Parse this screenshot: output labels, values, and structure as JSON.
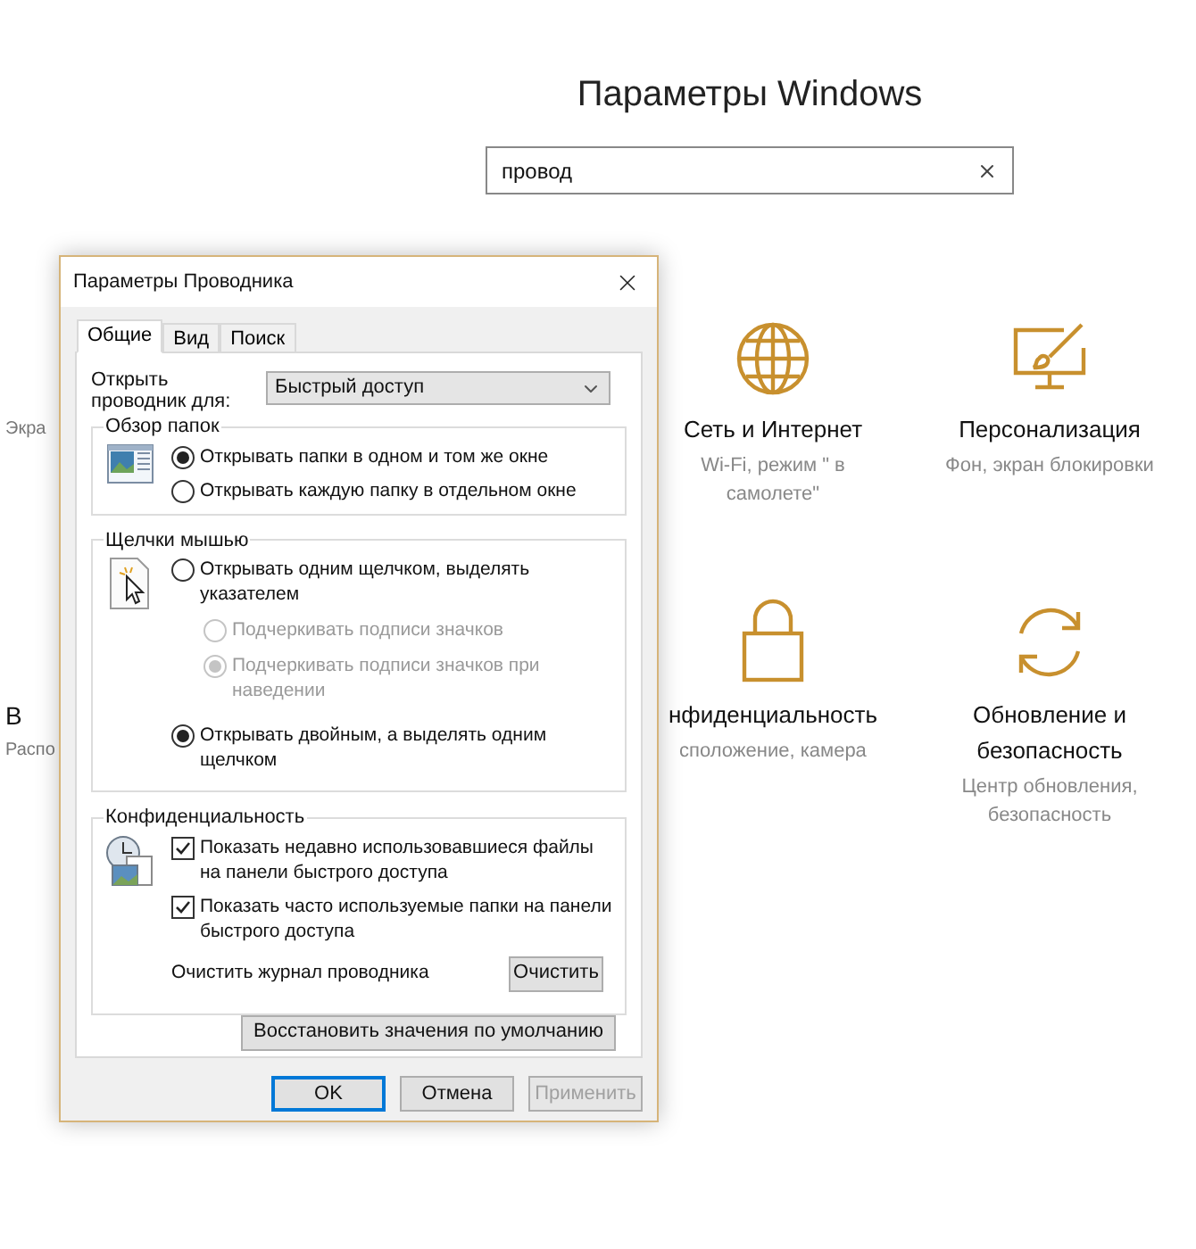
{
  "settings": {
    "title": "Параметры Windows",
    "search": {
      "value": "провод"
    },
    "rows": [
      [
        {
          "kind": "partial",
          "subtitle": "Экра"
        },
        {
          "kind": "full",
          "title": "Сеть и Интернет",
          "subtitle": "Wi-Fi, режим \" в самолете\""
        },
        {
          "kind": "full",
          "title": "Персонализация",
          "subtitle": "Фон, экран блокировки"
        }
      ],
      [
        {
          "kind": "partial",
          "title": "В",
          "subtitle": "Распо"
        },
        {
          "kind": "full",
          "title": "нфиденциальность",
          "subtitle": "сположение, камера"
        },
        {
          "kind": "full",
          "title": "Обновление и безопасность",
          "subtitle": "Центр обновления, безопасность"
        }
      ]
    ]
  },
  "dialog": {
    "title": "Параметры Проводника",
    "tabs": [
      {
        "label": "Общие",
        "selected": true
      },
      {
        "label": "Вид",
        "selected": false
      },
      {
        "label": "Поиск",
        "selected": false
      }
    ],
    "open_for": {
      "label": "Открыть проводник для:",
      "value": "Быстрый доступ"
    },
    "groups": [
      {
        "title": "Обзор папок",
        "options": [
          {
            "kind": "radio",
            "label": "Открывать папки в одном и том же окне",
            "selected": true,
            "disabled": false
          },
          {
            "kind": "radio",
            "label": "Открывать каждую папку в отдельном окне",
            "selected": false,
            "disabled": false
          }
        ]
      },
      {
        "title": "Щелчки мышью",
        "options": [
          {
            "kind": "radio",
            "label": "Открывать одним щелчком, выделять указателем",
            "selected": false,
            "disabled": false,
            "children": [
              {
                "kind": "radio",
                "label": "Подчеркивать подписи значков",
                "selected": false,
                "disabled": true
              },
              {
                "kind": "radio",
                "label": "Подчеркивать подписи значков при наведении",
                "selected": true,
                "disabled": true
              }
            ]
          },
          {
            "kind": "radio",
            "label": "Открывать двойным, а выделять одним щелчком",
            "selected": true,
            "disabled": false
          }
        ]
      },
      {
        "title": "Конфиденциальность",
        "options": [
          {
            "kind": "checkbox",
            "label": "Показать недавно использовавшиеся файлы на панели быстрого доступа",
            "checked": true
          },
          {
            "kind": "checkbox",
            "label": "Показать часто используемые папки на панели быстрого доступа",
            "checked": true
          }
        ],
        "action": {
          "label": "Очистить журнал проводника",
          "button": "Очистить"
        }
      }
    ],
    "restore_button": "Восстановить значения по умолчанию",
    "buttons": [
      {
        "label": "OK",
        "default": true,
        "disabled": false
      },
      {
        "label": "Отмена",
        "default": false,
        "disabled": false
      },
      {
        "label": "Применить",
        "default": false,
        "disabled": true
      }
    ]
  }
}
